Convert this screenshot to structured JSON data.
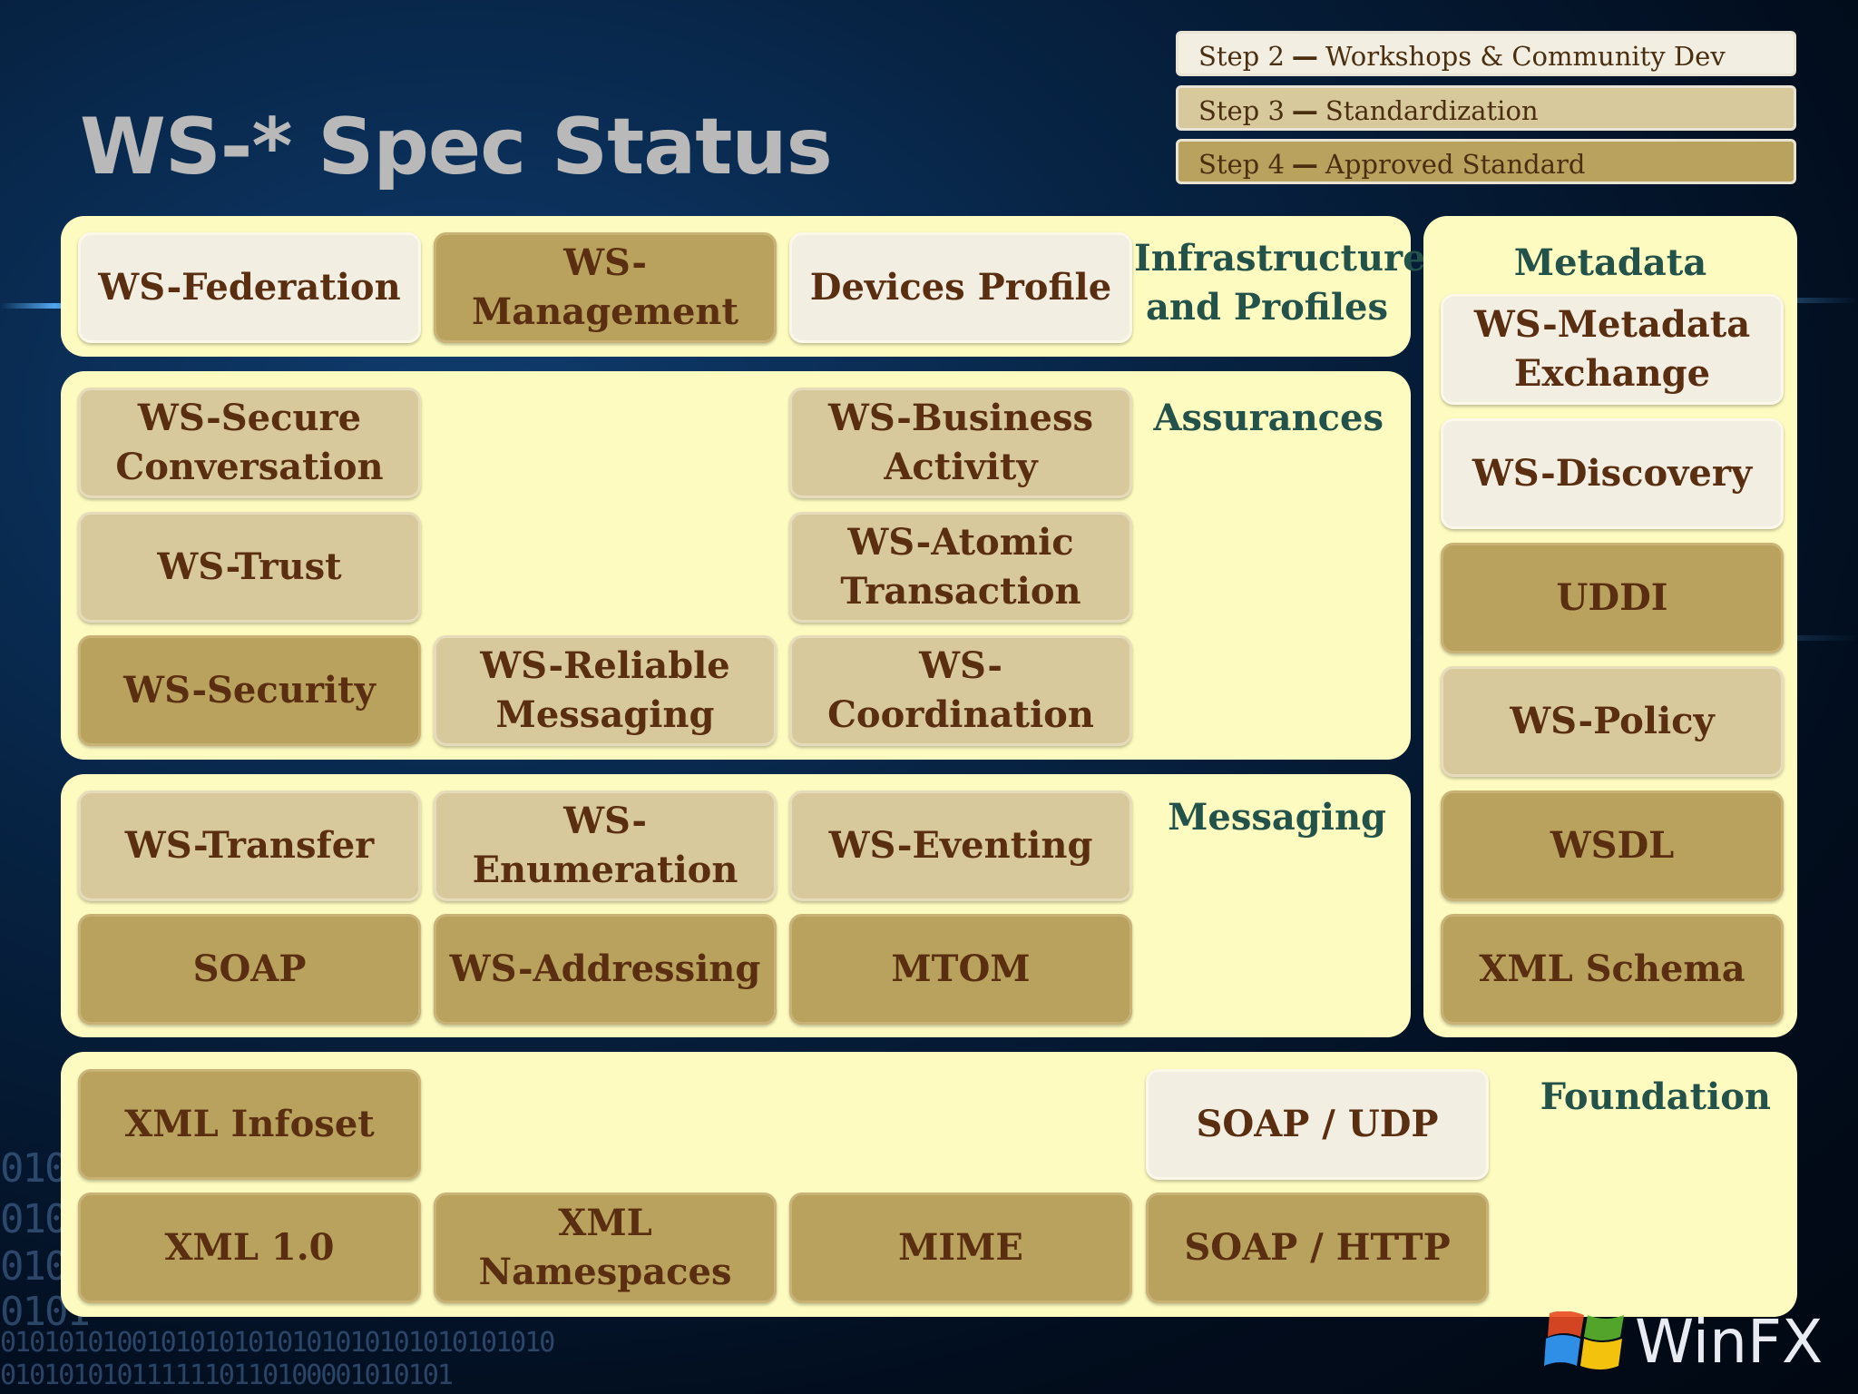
{
  "title": "WS-* Spec Status",
  "legend": [
    {
      "step": "Step 2",
      "label": "Workshops & Community Dev",
      "color": "#f2efe2"
    },
    {
      "step": "Step 3",
      "label": "Standardization",
      "color": "#d8c99c"
    },
    {
      "step": "Step 4",
      "label": "Approved Standard",
      "color": "#b9a15e"
    }
  ],
  "sections": {
    "infrastructure": {
      "title": "Infrastructure and Profiles",
      "items": [
        {
          "label": "WS-Federation",
          "status": "Step 2"
        },
        {
          "label": "WS-Management",
          "status": "Step 4"
        },
        {
          "label": "Devices Profile",
          "status": "Step 2"
        }
      ]
    },
    "assurances": {
      "title": "Assurances",
      "items": [
        {
          "label": "WS-Secure Conversation",
          "status": "Step 3"
        },
        {
          "label": "WS-Business Activity",
          "status": "Step 3"
        },
        {
          "label": "WS-Trust",
          "status": "Step 3"
        },
        {
          "label": "WS-Atomic Transaction",
          "status": "Step 3"
        },
        {
          "label": "WS-Security",
          "status": "Step 4"
        },
        {
          "label": "WS-Reliable Messaging",
          "status": "Step 3"
        },
        {
          "label": "WS-Coordination",
          "status": "Step 3"
        }
      ]
    },
    "messaging": {
      "title": "Messaging",
      "items": [
        {
          "label": "WS-Transfer",
          "status": "Step 3"
        },
        {
          "label": "WS-Enumeration",
          "status": "Step 3"
        },
        {
          "label": "WS-Eventing",
          "status": "Step 3"
        },
        {
          "label": "SOAP",
          "status": "Step 4"
        },
        {
          "label": "WS-Addressing",
          "status": "Step 4"
        },
        {
          "label": "MTOM",
          "status": "Step 4"
        }
      ]
    },
    "metadata": {
      "title": "Metadata",
      "items": [
        {
          "label": "WS-Metadata Exchange",
          "status": "Step 2"
        },
        {
          "label": "WS-Discovery",
          "status": "Step 2"
        },
        {
          "label": "UDDI",
          "status": "Step 4"
        },
        {
          "label": "WS-Policy",
          "status": "Step 3"
        },
        {
          "label": "WSDL",
          "status": "Step 4"
        },
        {
          "label": "XML Schema",
          "status": "Step 4"
        }
      ]
    },
    "foundation": {
      "title": "Foundation",
      "items": [
        {
          "label": "XML Infoset",
          "status": "Step 4"
        },
        {
          "label": "SOAP / UDP",
          "status": "Step 2"
        },
        {
          "label": "XML 1.0",
          "status": "Step 4"
        },
        {
          "label": "XML Namespaces",
          "status": "Step 4"
        },
        {
          "label": "MIME",
          "status": "Step 4"
        },
        {
          "label": "SOAP / HTTP",
          "status": "Step 4"
        }
      ]
    }
  },
  "logo": {
    "text": "WinFX",
    "icon": "windows-flag-icon"
  },
  "background_text": {
    "rows": [
      "0101",
      "0101",
      "0101",
      "0101",
      "01010101001010101010101010101010101010",
      "0101010101111110110100001010101"
    ]
  }
}
